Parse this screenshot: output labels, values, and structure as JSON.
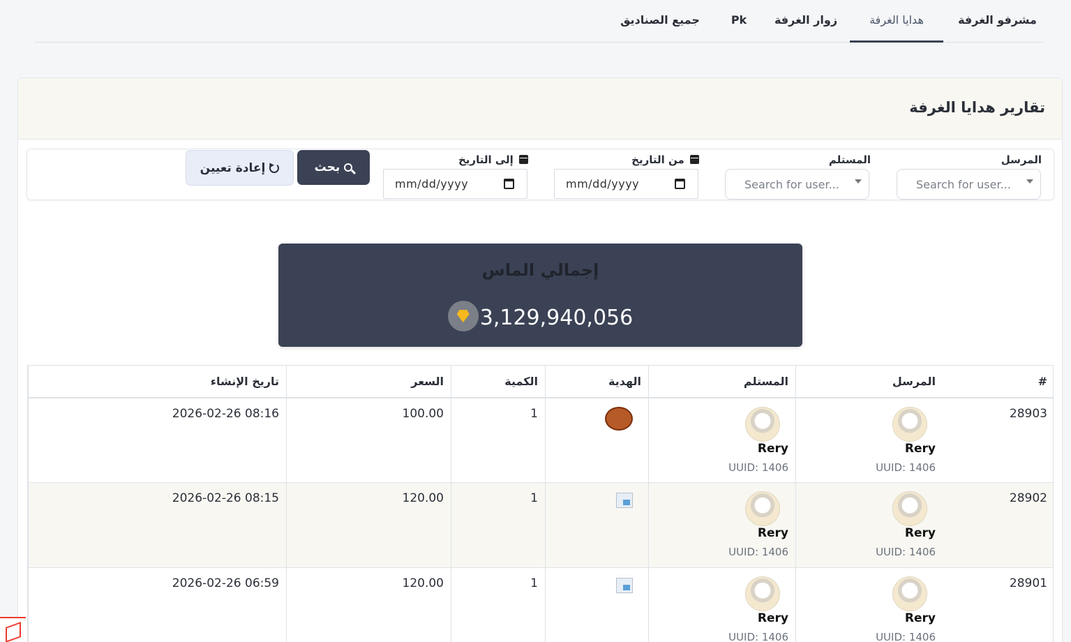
{
  "tabs": [
    {
      "label": "مشرفو الغرفة"
    },
    {
      "label": "هدايا الغرفة"
    },
    {
      "label": "زوار الغرفة"
    },
    {
      "label": "Pk"
    },
    {
      "label": "جميع الصناديق"
    }
  ],
  "card": {
    "title": "تقارير هدايا الغرفة"
  },
  "filters": {
    "sender_label": "المرسل",
    "sender_placeholder": "Search for user...",
    "receiver_label": "المستلم",
    "receiver_placeholder": "Search for user...",
    "from_date_label": "من التاريخ",
    "from_date_value": "mm/dd/yyyy",
    "to_date_label": "إلى التاريخ",
    "to_date_value": "mm/dd/yyyy",
    "search_label": "بحث",
    "reset_label": "إعادة تعيين"
  },
  "total": {
    "label": "إجمالي الماس",
    "value": "3,129,940,056"
  },
  "table": {
    "headers": [
      "#",
      "المرسل",
      "المستلم",
      "الهدية",
      "الكمية",
      "السعر",
      "تاريخ الإنشاء"
    ],
    "rows": [
      {
        "id": "28903",
        "sender": "Rery",
        "sender_uuid": "UUID: 1406",
        "receiver": "Rery",
        "receiver_uuid": "UUID: 1406",
        "qty": "1",
        "price": "100.00",
        "created": "2026-02-26 08:16"
      },
      {
        "id": "28902",
        "sender": "Rery",
        "sender_uuid": "UUID: 1406",
        "receiver": "Rery",
        "receiver_uuid": "UUID: 1406",
        "qty": "1",
        "price": "120.00",
        "created": "2026-02-26 08:15"
      },
      {
        "id": "28901",
        "sender": "Rery",
        "sender_uuid": "UUID: 1406",
        "receiver": "Rery",
        "receiver_uuid": "UUID: 1406",
        "qty": "1",
        "price": "120.00",
        "created": "2026-02-26 06:59"
      }
    ]
  },
  "colors": {
    "primary": "#3b4255",
    "header_bg": "#f8f7f2",
    "accent": "#f5b91e"
  }
}
